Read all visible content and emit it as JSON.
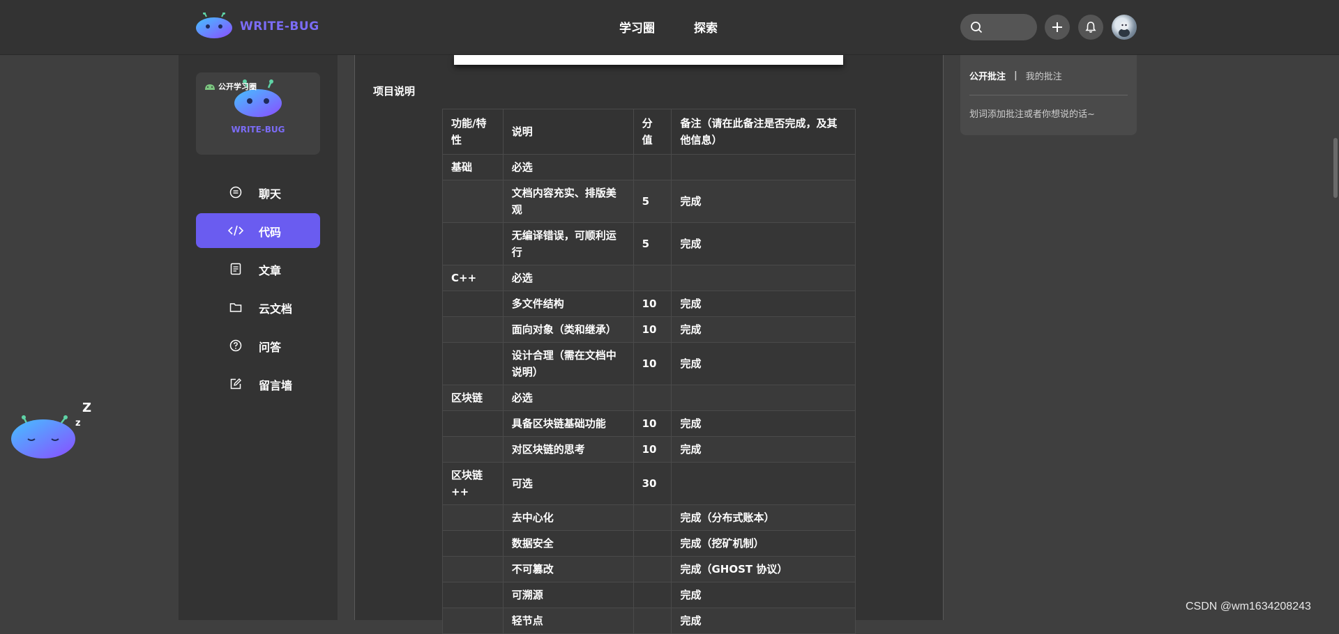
{
  "brand": {
    "name": "WRITE-BUG"
  },
  "nav": {
    "items": [
      "学习圈",
      "探索"
    ]
  },
  "sidebar": {
    "card_badge": "公开学习圈",
    "card_title": "WRITE-BUG",
    "menu": [
      {
        "label": "聊天",
        "icon": "chat-icon"
      },
      {
        "label": "代码",
        "icon": "code-icon",
        "active": true
      },
      {
        "label": "文章",
        "icon": "article-icon"
      },
      {
        "label": "云文档",
        "icon": "folder-icon"
      },
      {
        "label": "问答",
        "icon": "question-icon"
      },
      {
        "label": "留言墙",
        "icon": "edit-icon"
      }
    ]
  },
  "content": {
    "section_title": "项目说明",
    "table": {
      "headers": [
        "功能/特性",
        "说明",
        "分值",
        "备注（请在此备注是否完成，及其他信息）"
      ],
      "rows": [
        [
          "基础",
          "必选",
          "",
          ""
        ],
        [
          "",
          "文档内容充实、排版美观",
          "5",
          "完成"
        ],
        [
          "",
          "无编译错误，可顺利运行",
          "5",
          "完成"
        ],
        [
          "C++",
          "必选",
          "",
          ""
        ],
        [
          "",
          "多文件结构",
          "10",
          "完成"
        ],
        [
          "",
          "面向对象（类和继承）",
          "10",
          "完成"
        ],
        [
          "",
          "设计合理（需在文档中说明）",
          "10",
          "完成"
        ],
        [
          "区块链",
          "必选",
          "",
          ""
        ],
        [
          "",
          "具备区块链基础功能",
          "10",
          "完成"
        ],
        [
          "",
          "对区块链的思考",
          "10",
          "完成"
        ],
        [
          "区块链++",
          "可选",
          "30",
          ""
        ],
        [
          "",
          "去中心化",
          "",
          "完成（分布式账本）"
        ],
        [
          "",
          "数据安全",
          "",
          "完成（挖矿机制）"
        ],
        [
          "",
          "不可篡改",
          "",
          "完成（GHOST 协议）"
        ],
        [
          "",
          "可溯源",
          "",
          "完成"
        ],
        [
          "",
          "轻节点",
          "",
          "完成"
        ]
      ]
    }
  },
  "annotations": {
    "tab_public": "公开批注",
    "separator": "|",
    "tab_mine": "我的批注",
    "hint": "划词添加批注或者你想说的话~"
  },
  "mascot": {
    "sleep_big": "Z",
    "sleep_small": "z"
  },
  "watermark": "CSDN @wm1634208243",
  "colors": {
    "accent": "#6a5cf0",
    "brand_text": "#7b6cf6"
  }
}
